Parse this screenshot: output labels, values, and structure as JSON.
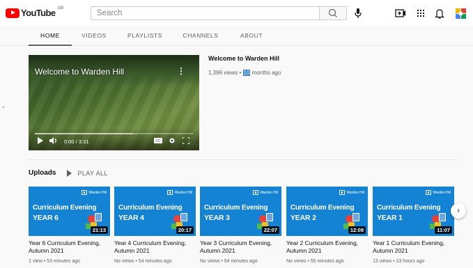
{
  "header": {
    "logo_text": "YouTube",
    "country_code": "GB",
    "search_placeholder": "Search",
    "icons": [
      "search-icon",
      "mic-icon",
      "create-video-icon",
      "apps-grid-icon",
      "notifications-bell-icon",
      "account-avatar-icon"
    ]
  },
  "tabs": [
    {
      "label": "HOME",
      "active": true
    },
    {
      "label": "VIDEOS",
      "active": false
    },
    {
      "label": "PLAYLISTS",
      "active": false
    },
    {
      "label": "CHANNELS",
      "active": false
    },
    {
      "label": "ABOUT",
      "active": false
    }
  ],
  "featured": {
    "overlay_title": "Welcome to Warden Hill",
    "title": "Welcome to Warden Hill",
    "views": "1,396 views • ",
    "age_highlight": "10",
    "age_rest": " months ago",
    "time": "0:00 / 3:31"
  },
  "uploads": {
    "title": "Uploads",
    "play_all": "PLAY ALL"
  },
  "videos": [
    {
      "thumb_line1": "Curriculum Evening",
      "thumb_line2": "YEAR 6",
      "duration": "21:13",
      "title": "Year 6 Curriculum Evening, Autumn 2021",
      "meta": "1 view • 53 minutes ago"
    },
    {
      "thumb_line1": "Curriculum Evening",
      "thumb_line2": "YEAR 4",
      "duration": "20:17",
      "title": "Year 4 Curriculum Evening, Autumn 2021",
      "meta": "No views • 54 minutes ago"
    },
    {
      "thumb_line1": "Curriculum Evening",
      "thumb_line2": "YEAR 3",
      "duration": "22:07",
      "title": "Year 3 Curriculum Evening, Autumn 2021",
      "meta": "No views • 54 minutes ago"
    },
    {
      "thumb_line1": "Curriculum Evening",
      "thumb_line2": "YEAR 2",
      "duration": "12:08",
      "title": "Year 2 Curriculum Evening, Autumn 2021",
      "meta": "No views • 55 minutes ago"
    },
    {
      "thumb_line1": "Curriculum Evening",
      "thumb_line2": "YEAR 1",
      "duration": "11:07",
      "title": "Year 1 Curriculum Evening, Autumn 2021",
      "meta": "13 views • 23 hours ago"
    }
  ],
  "thumb_brand": "Warden Hill",
  "colors": {
    "brand_red": "#ff0000",
    "thumb_blue": "#1583d4",
    "highlight": "#2f7fd4"
  }
}
